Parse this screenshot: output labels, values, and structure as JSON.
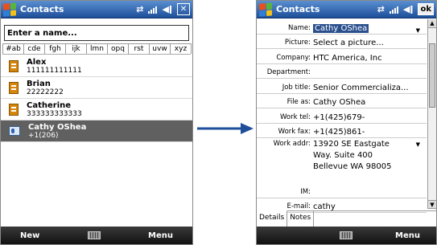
{
  "left": {
    "title": "Contacts",
    "search_placeholder": "Enter a name...",
    "tabs": [
      "#ab",
      "cde",
      "fgh",
      "ijk",
      "lmn",
      "opq",
      "rst",
      "uvw",
      "xyz"
    ],
    "contacts": [
      {
        "name": "Alex",
        "number": "111111111111"
      },
      {
        "name": "Brian",
        "number": "22222222"
      },
      {
        "name": "Catherine",
        "number": "333333333333"
      },
      {
        "name": "Cathy OShea",
        "number": "+1(206)"
      }
    ],
    "softkeys": {
      "left": "New",
      "right": "Menu"
    }
  },
  "right": {
    "title": "Contacts",
    "ok": "ok",
    "fields": [
      {
        "label": "Name:",
        "value": "Cathy OShea"
      },
      {
        "label": "Picture:",
        "value": "Select a picture..."
      },
      {
        "label": "Company:",
        "value": "HTC America, Inc"
      },
      {
        "label": "Department:",
        "value": ""
      },
      {
        "label": "Job title:",
        "value": "Senior Commercializa..."
      },
      {
        "label": "File as:",
        "value": "Cathy OShea"
      },
      {
        "label": "Work tel:",
        "value": "+1(425)679-"
      },
      {
        "label": "Work fax:",
        "value": "+1(425)861-"
      }
    ],
    "address": {
      "label": "Work addr:",
      "line1": "13920 SE Eastgate",
      "line2": "Way. Suite 400",
      "line3": "Bellevue WA 98005"
    },
    "im": {
      "label": "IM:",
      "value": ""
    },
    "email": {
      "label": "E-mail:",
      "value": "cathy"
    },
    "tabs": [
      "Details",
      "Notes"
    ],
    "softkeys": {
      "right": "Menu"
    }
  },
  "colors": {
    "titlebar": "#1d4f9a",
    "selection": "#606060",
    "arrow": "#1f4f9a"
  }
}
